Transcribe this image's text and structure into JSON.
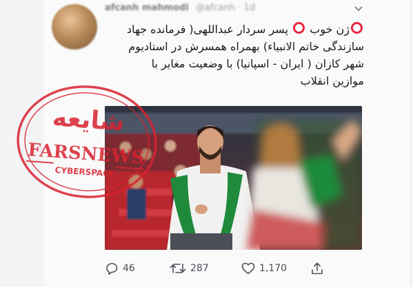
{
  "tweet": {
    "author_name": "afcanh mahmodi",
    "author_handle": "@afcanh · 1d",
    "text_lines": [
      "ژن خوب",
      "پسر سردار عبداللهی( فرمانده جهاد",
      "سازندگی خاتم الانبیاء) بهمراه همسرش در استادیوم",
      "شهر کازان ( ایران - اسپانیا) با وضعیت مغایر با",
      "موازین انقلاب"
    ]
  },
  "stamp": {
    "title": "شایعه",
    "brand": "FARSNEWS",
    "sub": "CYBERSPACE",
    "color": "#d9232f"
  },
  "actions": {
    "reply_count": "46",
    "retweet_count": "287",
    "like_count": "1,170"
  },
  "icons": [
    "chevron-down-icon",
    "reply-icon",
    "retweet-icon",
    "like-icon",
    "share-icon"
  ],
  "colors": {
    "marker_red": "#e8253d",
    "icon_gray": "#4a5058"
  }
}
